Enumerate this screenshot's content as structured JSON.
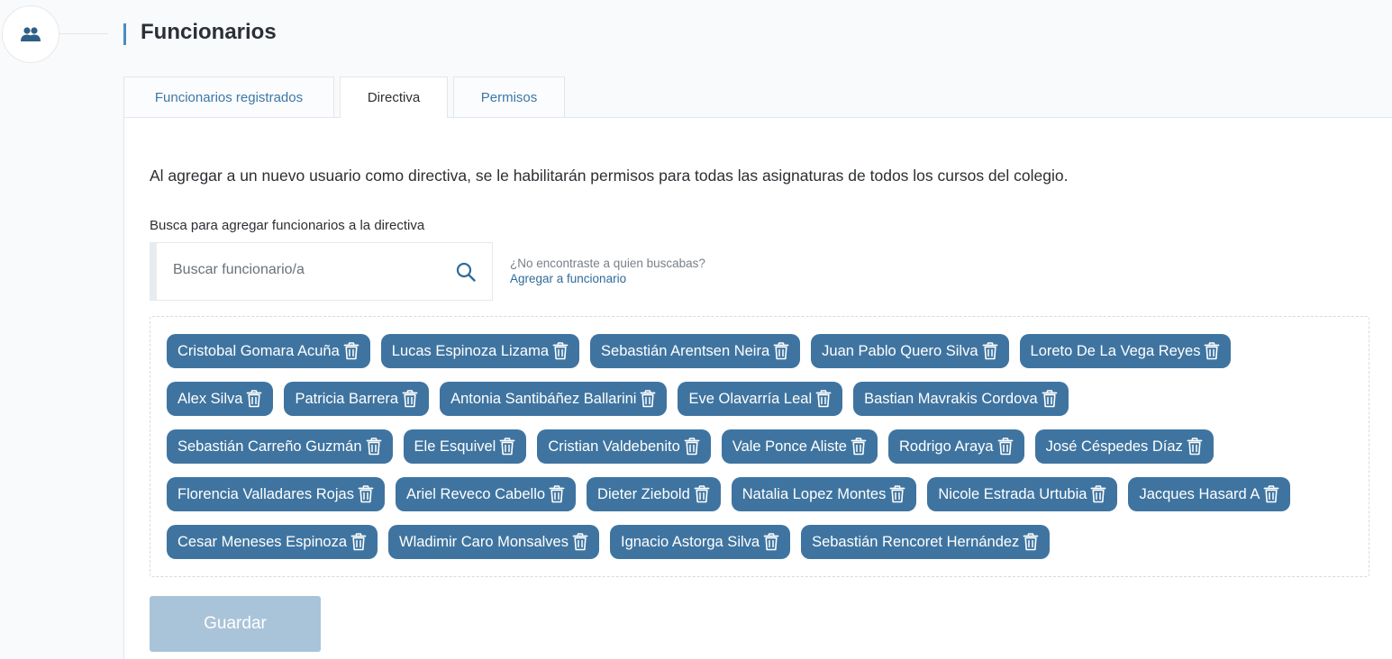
{
  "header": {
    "title": "Funcionarios",
    "icon": "users-icon"
  },
  "tabs": [
    {
      "label": "Funcionarios registrados",
      "active": false
    },
    {
      "label": "Directiva",
      "active": true
    },
    {
      "label": "Permisos",
      "active": false
    }
  ],
  "panel": {
    "info_text": "Al agregar a un nuevo usuario como directiva, se le habilitarán permisos para todas las asignaturas de todos los cursos del colegio.",
    "search_label": "Busca para agregar funcionarios a la directiva",
    "search_placeholder": "Buscar funcionario/a",
    "search_value": "",
    "not_found_question": "¿No encontraste a quien buscabas?",
    "add_link": "Agregar a funcionario",
    "save_label": "Guardar"
  },
  "members": [
    [
      "Cristobal Gomara Acuña",
      "Lucas Espinoza Lizama",
      "Sebastián Arentsen Neira",
      "Juan Pablo Quero Silva",
      "Loreto De La Vega Reyes"
    ],
    [
      "Alex Silva",
      "Patricia Barrera",
      "Antonia Santibáñez Ballarini",
      "Eve Olavarría Leal",
      "Bastian Mavrakis Cordova"
    ],
    [
      "Sebastián Carreño Guzmán",
      "Ele Esquivel",
      "Cristian Valdebenito",
      "Vale Ponce Aliste",
      "Rodrigo Araya",
      "José Céspedes Díaz"
    ],
    [
      "Florencia Valladares Rojas",
      "Ariel Reveco Cabello",
      "Dieter Ziebold",
      "Natalia Lopez Montes",
      "Nicole Estrada Urtubia",
      "Jacques Hasard A"
    ],
    [
      "Cesar Meneses Espinoza",
      "Wladimir Caro Monsalves",
      "Ignacio Astorga Silva",
      "Sebastián Rencoret Hernández"
    ]
  ],
  "colors": {
    "chip": "#3f74a0",
    "accent": "#4a8cc0",
    "link": "#2f6b9a",
    "save_disabled": "#a9c4d9"
  }
}
